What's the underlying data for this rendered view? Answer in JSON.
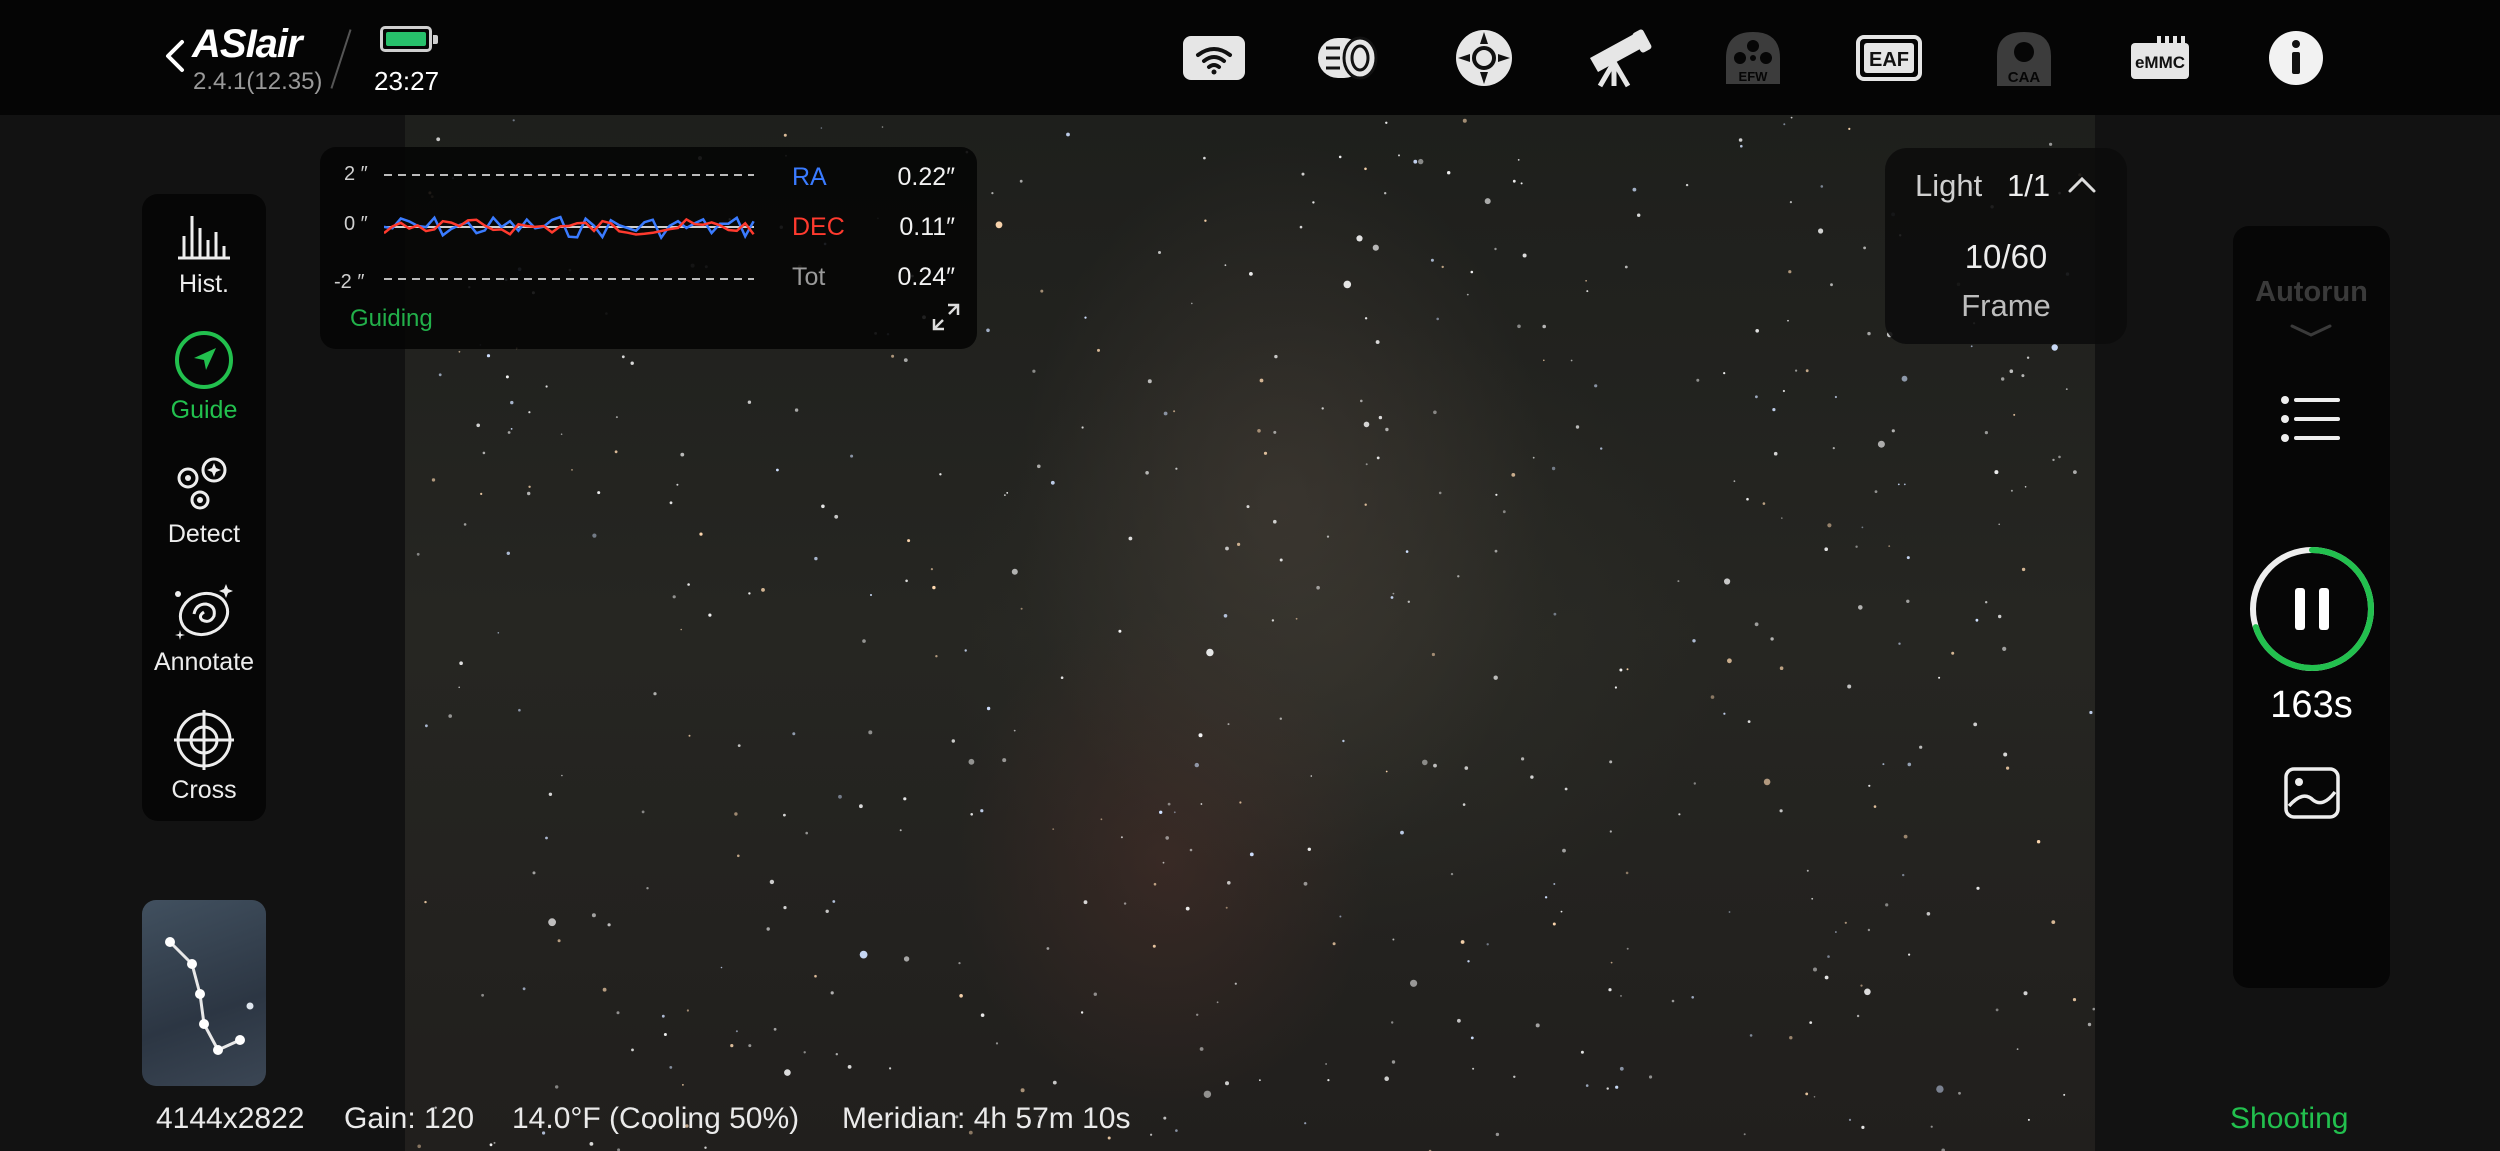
{
  "header": {
    "brand": "ASIair",
    "version": "2.4.1(12.35)",
    "time": "23:27",
    "device_icons": [
      "wifi-icon",
      "camera-icon",
      "guide-camera-icon",
      "telescope-icon",
      "efw-icon",
      "eaf-icon",
      "caa-icon",
      "emmc-icon",
      "info-icon"
    ],
    "efw_label": "EFW",
    "eaf_label": "EAF",
    "caa_label": "CAA",
    "emmc_label": "eMMC"
  },
  "tools": [
    {
      "label": "Hist.",
      "icon": "histogram-icon",
      "active": false
    },
    {
      "label": "Guide",
      "icon": "guide-icon",
      "active": true
    },
    {
      "label": "Detect",
      "icon": "detect-stars-icon",
      "active": false
    },
    {
      "label": "Annotate",
      "icon": "annotate-galaxy-icon",
      "active": false
    },
    {
      "label": "Cross",
      "icon": "crosshair-icon",
      "active": false
    }
  ],
  "guide_graph": {
    "ticks": [
      "2 ″",
      "0 ″",
      "-2 ″"
    ],
    "ra_label": "RA",
    "ra_value": "0.22″",
    "dec_label": "DEC",
    "dec_value": "0.11″",
    "tot_label": "Tot",
    "tot_value": "0.24″",
    "status": "Guiding",
    "colors": {
      "ra": "#3a7bff",
      "dec": "#ff3a2e",
      "status": "#22b04a"
    }
  },
  "light_panel": {
    "type": "Light",
    "count": "1/1",
    "frames": "10/60",
    "frames_label": "Frame"
  },
  "autorun": {
    "label": "Autorun",
    "remaining": "163s",
    "progress": 0.7
  },
  "status_bar": {
    "resolution": "4144x2822",
    "gain": "Gain: 120",
    "temperature": "14.0°F (Cooling 50%)",
    "meridian": "Meridian: 4h 57m 10s",
    "state": "Shooting"
  }
}
